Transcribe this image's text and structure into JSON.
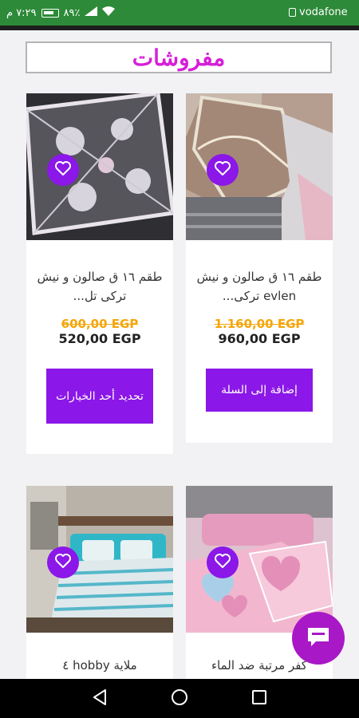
{
  "status_bar": {
    "time": "٧:٢٩ م",
    "battery": "٨٩٪",
    "carrier": "vodafone"
  },
  "page_title": "مفروشات",
  "products": [
    {
      "name": "طقم ١٦ ق صالون و نيش evlen تركى...",
      "old_price": "1.160,00 EGP",
      "price": "960,00 EGP",
      "button": "إضافة إلى السلة"
    },
    {
      "name": "طقم ١٦ ق صالون و نيش تركى تل...",
      "old_price": "600,00 EGP",
      "price": "520,00 EGP",
      "button": "تحديد أحد الخيارات"
    },
    {
      "name": "كفر مرتبة ضد الماء"
    },
    {
      "name": "ملاية hobby ٤"
    }
  ],
  "icons": {
    "wishlist": "heart-outline-icon",
    "chat": "chat-icon",
    "wifi": "wifi-icon",
    "signal": "signal-icon",
    "nav_back": "back-triangle-icon",
    "nav_home": "home-circle-icon",
    "nav_recents": "recents-square-icon"
  },
  "colors": {
    "status_bar": "#2d8a39",
    "title": "#d61fd8",
    "accent": "#8b17e8",
    "old_price": "#f4a60c",
    "chat_fab": "#a818c6"
  }
}
